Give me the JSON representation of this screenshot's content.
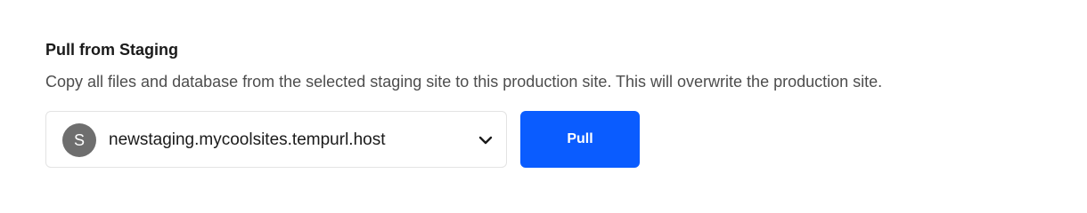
{
  "section": {
    "title": "Pull from Staging",
    "description": "Copy all files and database from the selected staging site to this production site. This will overwrite the production site."
  },
  "site_select": {
    "avatar_letter": "S",
    "selected_value": "newstaging.mycoolsites.tempurl.host",
    "icon": "chevron-down-icon"
  },
  "actions": {
    "pull_label": "Pull"
  },
  "colors": {
    "accent": "#0a5cff",
    "avatar_bg": "#6e6e6e"
  }
}
